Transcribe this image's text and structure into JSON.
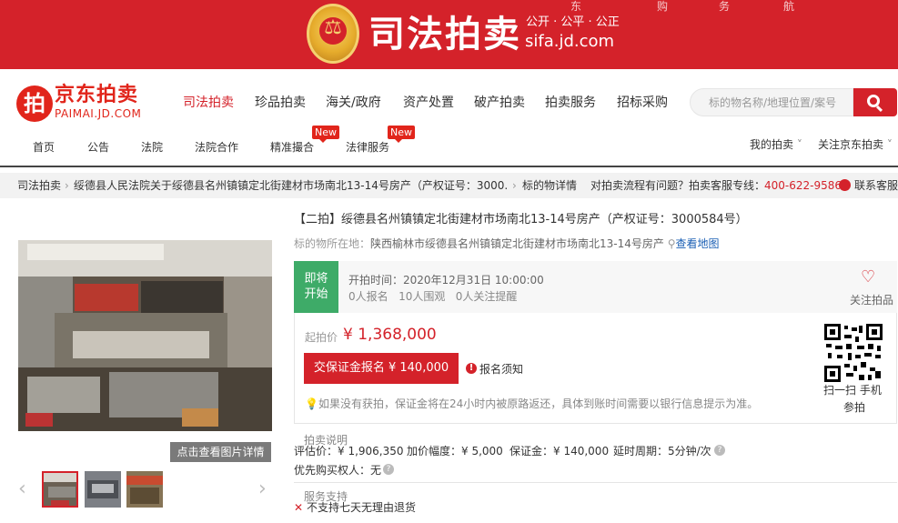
{
  "banner": {
    "title": "司法拍卖",
    "slogan": "公开 · 公平 · 公正",
    "domain": "sifa.jd.com",
    "top_nav": [
      "东",
      "购",
      "务",
      "航"
    ],
    "bg_color": "#d4222a"
  },
  "logo": {
    "cn": "京东拍卖",
    "en": "PAIMAI.JD.COM"
  },
  "main_nav": [
    "司法拍卖",
    "珍品拍卖",
    "海关/政府",
    "资产处置",
    "破产拍卖",
    "拍卖服务",
    "招标采购"
  ],
  "search": {
    "placeholder": "标的物名称/地理位置/案号",
    "icon": "search-icon"
  },
  "sub_nav": [
    "首页",
    "公告",
    "法院",
    "法院合作",
    "精准撮合",
    "法律服务"
  ],
  "new_badge": "New",
  "user_menu": {
    "my_auction": "我的拍卖",
    "follow": "关注京东拍卖"
  },
  "breadcrumb": {
    "root": "司法拍卖",
    "item": "绥德县人民法院关于绥德县名州镇镇定北街建材市场南北13-14号房产（产权证号：3000...",
    "detail": "标的物详情",
    "help_text": "对拍卖流程有问题？拍卖客服专线：",
    "hotline": "400-622-9586",
    "contact": "联系客服"
  },
  "gallery": {
    "view_details": "点击查看图片详情",
    "thumbnail_count": 3
  },
  "item": {
    "title": "【二拍】绥德县名州镇镇定北街建材市场南北13-14号房产（产权证号：3000584号）",
    "location_label": "标的物所在地：",
    "location": "陕西榆林市绥德县名州镇镇定北街建材市场南北13-14号房产",
    "map_link": "查看地图"
  },
  "status": {
    "badge_line1": "即将",
    "badge_line2": "开始",
    "start_time": "开拍时间：2020年12月31日 10:00:00",
    "stats": "0人报名   10人围观   0人关注提醒",
    "follow_label": "关注拍品"
  },
  "price": {
    "label": "起拍价",
    "value": "¥ 1,368,000",
    "apply_button": "交保证金报名 ¥ 140,000",
    "notice": "报名须知",
    "refund_tip": "如果没有获拍，保证金将在24小时内被原路返还，具体到账时间需要以银行信息提示为准。",
    "qr_caption": "扫一扫 手机",
    "qr_caption2": "参拍"
  },
  "auction_info": {
    "section": "拍卖说明",
    "appraisal": "评估价：¥ 1,906,350",
    "increment": "加价幅度：¥ 5,000",
    "deposit": "保证金：¥ 140,000",
    "delay": "延时周期：5分钟/次",
    "priority": "优先购买权人：无"
  },
  "service": {
    "section": "服务支持",
    "no_return": "不支持七天无理由退货"
  }
}
